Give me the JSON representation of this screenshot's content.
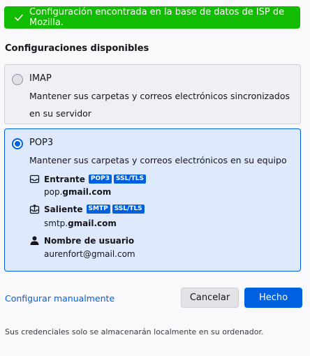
{
  "banner": {
    "text": "Configuración encontrada en la base de datos de ISP de Mozilla.",
    "icon": "check-icon",
    "color": "#12bc00"
  },
  "section_title": "Configuraciones disponibles",
  "options": {
    "imap": {
      "name": "IMAP",
      "description": "Mantener sus carpetas y correos electrónicos sincronizados en su servidor",
      "selected": false
    },
    "pop3": {
      "name": "POP3",
      "description": "Mantener sus carpetas y correos electrónicos en su equipo",
      "selected": true,
      "incoming": {
        "label": "Entrante",
        "badges": [
          "POP3",
          "SSL/TLS"
        ],
        "host_prefix": "pop.",
        "host_domain": "gmail.com"
      },
      "outgoing": {
        "label": "Saliente",
        "badges": [
          "SMTP",
          "SSL/TLS"
        ],
        "host_prefix": "smtp.",
        "host_domain": "gmail.com"
      },
      "username": {
        "label": "Nombre de usuario",
        "value": "aurenfort@gmail.com"
      }
    }
  },
  "actions": {
    "manual_link": "Configurar manualmente",
    "cancel": "Cancelar",
    "done": "Hecho"
  },
  "footnote": "Sus credenciales solo se almacenarán localmente en su ordenador.",
  "colors": {
    "accent": "#0061e0",
    "selected_bg": "#deeafc"
  }
}
